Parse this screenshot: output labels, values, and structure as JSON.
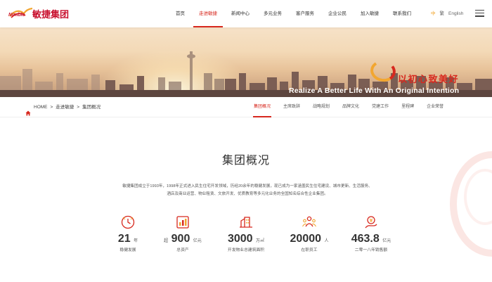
{
  "header": {
    "logo_en": "Nimble",
    "logo_cn": "敏捷集团",
    "nav": [
      "首页",
      "走进敏捷",
      "新闻中心",
      "多元业务",
      "客户服务",
      "企业公民",
      "加入敏捷",
      "联系我们"
    ],
    "lang_cn1": "中",
    "lang_cn2": "繁",
    "lang_en": "English"
  },
  "banner": {
    "slogan_cn": "以初心致美好",
    "slogan_en": "Realize A Better Life With An Original Intention"
  },
  "breadcrumb": {
    "home": "HOME",
    "sep": ">",
    "level1": "走进敏捷",
    "level2": "集团概况"
  },
  "subnav": [
    "集团概况",
    "主席致辞",
    "战略规划",
    "品牌文化",
    "党建工作",
    "里程碑",
    "企业荣誉"
  ],
  "main": {
    "title": "集团概况",
    "intro_line1": "敏捷集团成立于1993年，1998年正式进入民生住宅开发领域，历经20余年的稳健发展，现已成为一家涵盖民生住宅建设、城市更新、生活服务、",
    "intro_line2": "酒店及商业运营、物业租赁、文旅开发、优质教育等多元化业务的全国知名综合性企业集团。"
  },
  "stats": [
    {
      "icon": "development-years-icon",
      "pre": "",
      "value": "21",
      "unit": "年",
      "caption": "稳健发展"
    },
    {
      "icon": "total-assets-icon",
      "pre": "超",
      "value": "900",
      "unit": "亿元",
      "caption": "总资产"
    },
    {
      "icon": "building-area-icon",
      "pre": "",
      "value": "3000",
      "unit": "万㎡",
      "caption": "开发物业总建筑面积"
    },
    {
      "icon": "employees-icon",
      "pre": "",
      "value": "20000",
      "unit": "人",
      "caption": "在职员工"
    },
    {
      "icon": "sales-amount-icon",
      "pre": "",
      "value": "463.8",
      "unit": "亿元",
      "caption": "二零一八年销售额"
    }
  ],
  "colors": {
    "accent": "#d7281e",
    "gold": "#f2a630"
  }
}
